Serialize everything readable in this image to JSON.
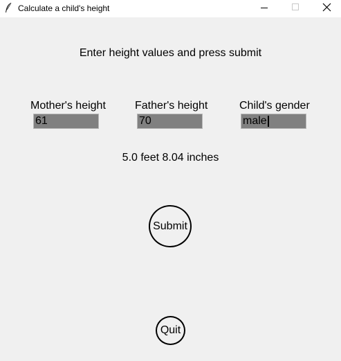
{
  "window": {
    "title": "Calculate a child's height",
    "icon": "feather-icon",
    "controls": [
      "minimize-icon",
      "maximize-icon",
      "close-icon"
    ]
  },
  "main": {
    "instruction": "Enter height values and press submit",
    "fields": {
      "mother": {
        "label": "Mother's height",
        "value": "61"
      },
      "father": {
        "label": "Father's height",
        "value": "70"
      },
      "gender": {
        "label": "Child's gender",
        "value": "male"
      }
    },
    "result": "5.0 feet 8.04 inches",
    "submit_label": "Submit",
    "quit_label": "Quit"
  },
  "colors": {
    "background": "#f0f0f0",
    "titlebar": "#ffffff",
    "field_background": "#808080"
  }
}
